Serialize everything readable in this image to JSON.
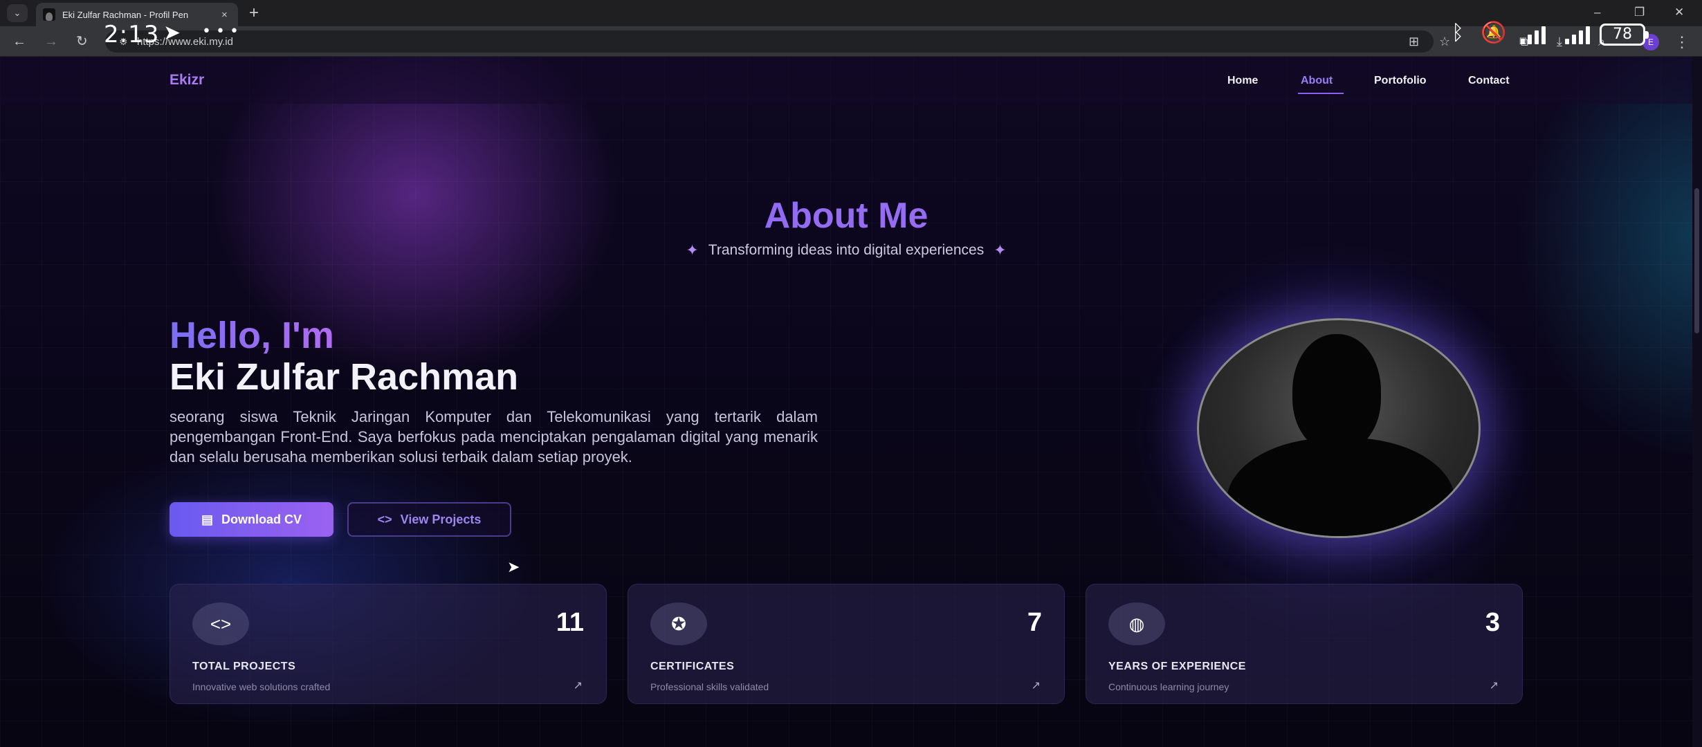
{
  "browser": {
    "tab_title": "Eki Zulfar Rachman - Profil Pen",
    "tab_close": "×",
    "new_tab": "+",
    "url": "https://www.eki.my.id",
    "window_controls": {
      "minimize": "–",
      "restore": "❐",
      "close": "✕"
    },
    "profile_initial": "E"
  },
  "status_bar": {
    "time": "2:13",
    "more": "• • •",
    "battery": "78"
  },
  "nav": {
    "brand": "Ekizr",
    "links": [
      "Home",
      "About",
      "Portofolio",
      "Contact"
    ],
    "active": "About"
  },
  "about": {
    "title": "About Me",
    "subtitle": "Transforming ideas into digital experiences",
    "greeting": "Hello, I'm",
    "name": "Eki Zulfar Rachman",
    "bio": "seorang siswa Teknik Jaringan Komputer dan Telekomunikasi yang tertarik dalam pengembangan Front-End. Saya berfokus pada menciptakan pengalaman digital yang menarik dan selalu berusaha memberikan solusi terbaik dalam setiap proyek.",
    "download_cv": "Download CV",
    "view_projects": "View Projects"
  },
  "stats": [
    {
      "icon": "code-icon",
      "value": "11",
      "label": "TOTAL PROJECTS",
      "desc": "Innovative web solutions crafted"
    },
    {
      "icon": "award-icon",
      "value": "7",
      "label": "CERTIFICATES",
      "desc": "Professional skills validated"
    },
    {
      "icon": "globe-icon",
      "value": "3",
      "label": "YEARS OF EXPERIENCE",
      "desc": "Continuous learning journey"
    }
  ],
  "colors": {
    "accent": "#8a62f0",
    "page_bg": "#0b0618"
  }
}
